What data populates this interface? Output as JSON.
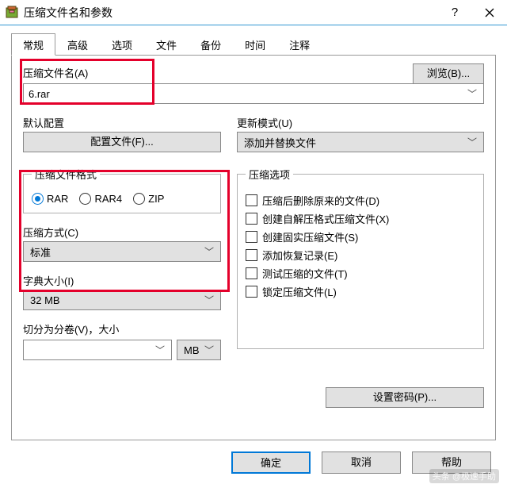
{
  "window": {
    "title": "压缩文件名和参数"
  },
  "tabs": [
    "常规",
    "高级",
    "选项",
    "文件",
    "备份",
    "时间",
    "注释"
  ],
  "activeTab": 0,
  "browse_label": "浏览(B)...",
  "filename_label": "压缩文件名(A)",
  "filename_value": "6.rar",
  "default_profile_label": "默认配置",
  "profiles_button": "配置文件(F)...",
  "update_mode_label": "更新模式(U)",
  "update_mode_value": "添加并替换文件",
  "format_legend": "压缩文件格式",
  "formats": {
    "rar": "RAR",
    "rar4": "RAR4",
    "zip": "ZIP"
  },
  "format_selected": "rar",
  "compression_method_label": "压缩方式(C)",
  "compression_method_value": "标准",
  "dict_label": "字典大小(I)",
  "dict_value": "32 MB",
  "split_label": "切分为分卷(V)，大小",
  "split_value": "",
  "split_unit": "MB",
  "options_legend": "压缩选项",
  "options": [
    "压缩后删除原来的文件(D)",
    "创建自解压格式压缩文件(X)",
    "创建固实压缩文件(S)",
    "添加恢复记录(E)",
    "测试压缩的文件(T)",
    "锁定压缩文件(L)"
  ],
  "password_button": "设置密码(P)...",
  "ok": "确定",
  "cancel": "取消",
  "help": "帮助",
  "watermark": "头条 @极速手助"
}
